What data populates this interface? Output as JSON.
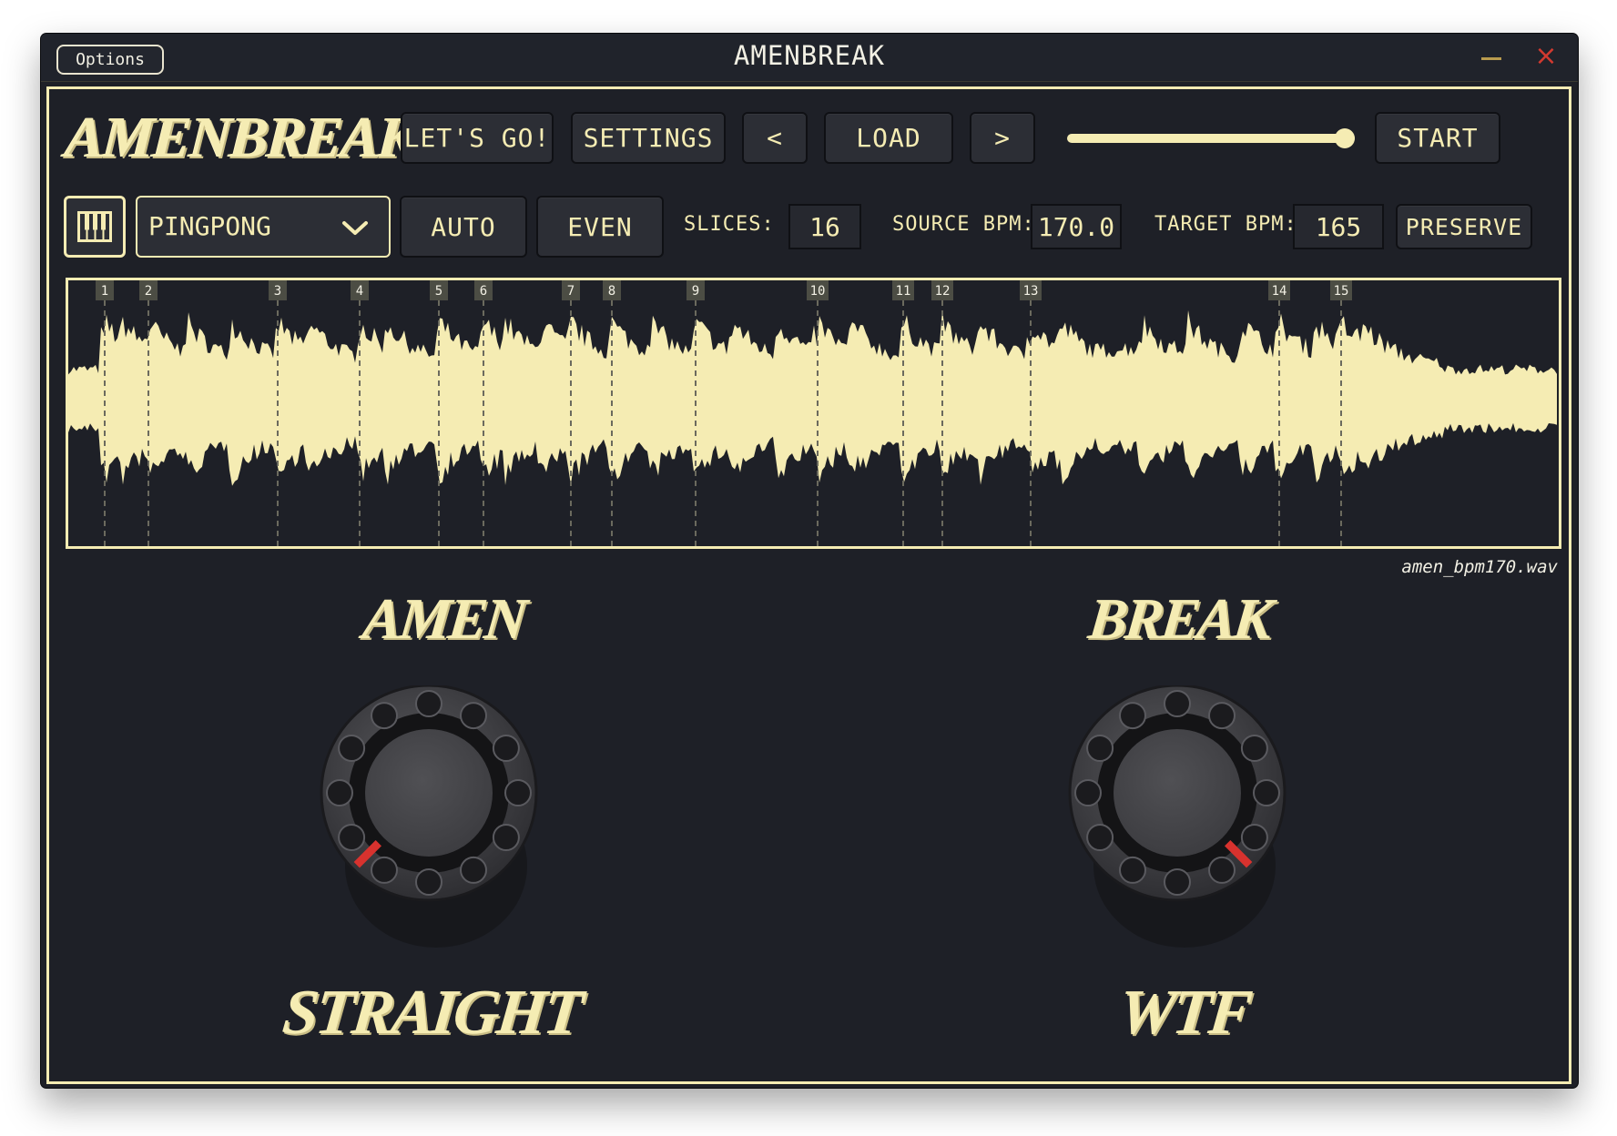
{
  "window": {
    "title": "AMENBREAK",
    "options_label": "Options"
  },
  "colors": {
    "accent": "#f5ecb3",
    "background": "#1e2027",
    "button": "#2c2e35",
    "knob_indicator": "#d8322e",
    "close": "#d23a30",
    "minimize": "#b99b4e"
  },
  "header": {
    "logo_text": "AMENBREAK",
    "lets_go_label": "LET'S GO!",
    "settings_label": "SETTINGS",
    "prev_label": "<",
    "load_label": "LOAD",
    "next_label": ">",
    "volume_level": 1.0,
    "start_label": "START"
  },
  "controls": {
    "keyboard_icon": "piano-keys-icon",
    "mode_selected": "PINGPONG",
    "auto_label": "AUTO",
    "even_label": "EVEN",
    "slices_label": "SLICES:",
    "slices_value": "16",
    "source_bpm_label": "SOURCE BPM:",
    "source_bpm_value": "170.0",
    "target_bpm_label": "TARGET BPM:",
    "target_bpm_value": "165",
    "preserve_label": "PRESERVE"
  },
  "waveform": {
    "filename": "amen_bpm170.wav",
    "markers": [
      "1",
      "2",
      "3",
      "4",
      "5",
      "6",
      "7",
      "8",
      "9",
      "10",
      "11",
      "12",
      "13",
      "14",
      "15"
    ]
  },
  "knobs": [
    {
      "top_label": "AMEN",
      "bottom_label": "STRAIGHT",
      "value": 0.0
    },
    {
      "top_label": "BREAK",
      "bottom_label": "WTF",
      "value": 1.0
    }
  ]
}
